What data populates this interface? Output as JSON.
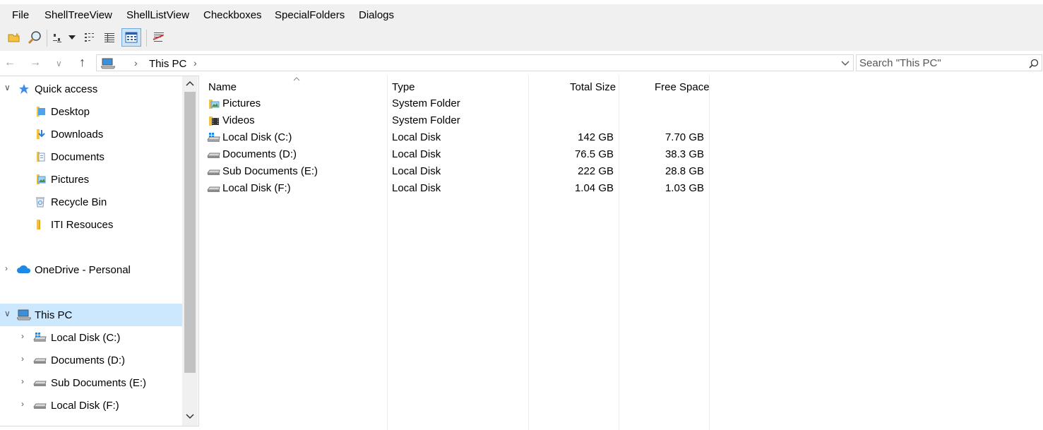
{
  "menu": [
    "File",
    "ShellTreeView",
    "ShellListView",
    "Checkboxes",
    "SpecialFolders",
    "Dialogs"
  ],
  "toolbar": {
    "icons": [
      "open-folder-icon",
      "find-icon",
      "large-icons-view-icon",
      "view-dropdown-icon",
      "list-view-icon",
      "details-view-icon",
      "report-view-icon",
      "properties-icon"
    ]
  },
  "address": {
    "location": "This PC",
    "search_placeholder": "Search  \"This PC\""
  },
  "tree": {
    "items": [
      {
        "label": "Quick access",
        "icon": "star-icon"
      },
      {
        "label": "Desktop",
        "icon": "desktop-folder-icon"
      },
      {
        "label": "Downloads",
        "icon": "downloads-folder-icon"
      },
      {
        "label": "Documents",
        "icon": "documents-folder-icon"
      },
      {
        "label": "Pictures",
        "icon": "pictures-folder-icon"
      },
      {
        "label": "Recycle Bin",
        "icon": "recycle-bin-icon"
      },
      {
        "label": "ITI Resouces",
        "icon": "folder-icon"
      },
      {
        "label": "OneDrive - Personal",
        "icon": "onedrive-cloud-icon"
      },
      {
        "label": "This PC",
        "icon": "computer-icon"
      },
      {
        "label": "Local Disk (C:)",
        "icon": "windows-drive-icon"
      },
      {
        "label": "Documents (D:)",
        "icon": "drive-icon"
      },
      {
        "label": "Sub Documents (E:)",
        "icon": "drive-icon"
      },
      {
        "label": "Local Disk (F:)",
        "icon": "drive-icon"
      }
    ]
  },
  "list": {
    "columns": [
      "Name",
      "Type",
      "Total Size",
      "Free Space"
    ],
    "rows": [
      {
        "name": "Pictures",
        "type": "System Folder",
        "total": "",
        "free": "",
        "icon": "pictures-folder-icon"
      },
      {
        "name": "Videos",
        "type": "System Folder",
        "total": "",
        "free": "",
        "icon": "videos-folder-icon"
      },
      {
        "name": "Local Disk (C:)",
        "type": "Local Disk",
        "total": "142 GB",
        "free": "7.70 GB",
        "icon": "windows-drive-icon"
      },
      {
        "name": "Documents (D:)",
        "type": "Local Disk",
        "total": "76.5 GB",
        "free": "38.3 GB",
        "icon": "drive-icon"
      },
      {
        "name": "Sub Documents (E:)",
        "type": "Local Disk",
        "total": "222 GB",
        "free": "28.8 GB",
        "icon": "drive-icon"
      },
      {
        "name": "Local Disk (F:)",
        "type": "Local Disk",
        "total": "1.04 GB",
        "free": "1.03 GB",
        "icon": "drive-icon"
      }
    ]
  },
  "colors": {
    "selection": "#cce8ff",
    "chrome": "#f0f0f0",
    "folder": "#f3c242",
    "accent": "#1e88e5"
  }
}
